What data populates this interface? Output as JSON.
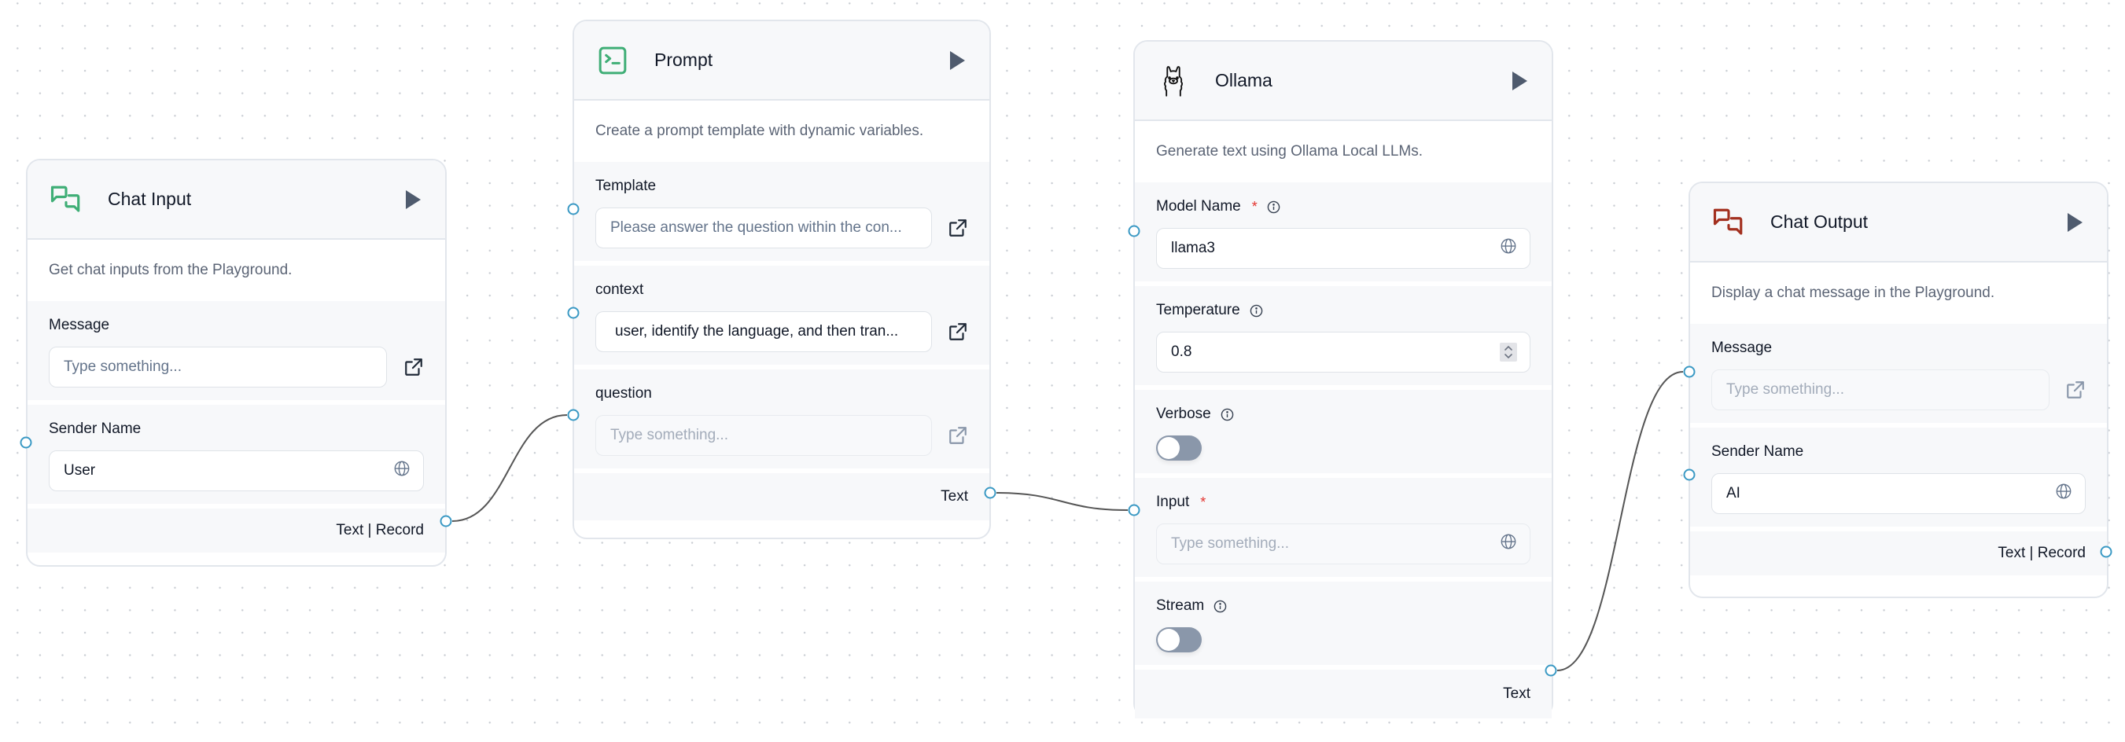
{
  "canvas": {
    "edge_color": "#555555",
    "handle_color": "#3a99c4"
  },
  "nodes": {
    "chat_input": {
      "title": "Chat Input",
      "icon": "chat-bubbles-icon",
      "icon_color": "#3fae76",
      "description": "Get chat inputs from the Playground.",
      "fields": {
        "message": {
          "label": "Message",
          "value": "",
          "placeholder": "Type something..."
        },
        "sender_name": {
          "label": "Sender Name",
          "value": "User"
        }
      },
      "output": "Text | Record"
    },
    "prompt": {
      "title": "Prompt",
      "icon": "terminal-square-icon",
      "icon_color": "#3fae76",
      "description": "Create a prompt template with dynamic variables.",
      "fields": {
        "template": {
          "label": "Template",
          "value": "Please answer the question within the con..."
        },
        "context": {
          "label": "context",
          "value": "user, identify the language, and then tran..."
        },
        "question": {
          "label": "question",
          "value": "",
          "placeholder": "Type something..."
        }
      },
      "output": "Text"
    },
    "ollama": {
      "title": "Ollama",
      "icon": "llama-icon",
      "description": "Generate text using Ollama Local LLMs.",
      "fields": {
        "model_name": {
          "label": "Model Name",
          "required": "*",
          "value": "llama3"
        },
        "temperature": {
          "label": "Temperature",
          "value": "0.8"
        },
        "verbose": {
          "label": "Verbose",
          "enabled": false
        },
        "input": {
          "label": "Input",
          "required": "*",
          "value": "",
          "placeholder": "Type something..."
        },
        "stream": {
          "label": "Stream",
          "enabled": false
        }
      },
      "output": "Text"
    },
    "chat_output": {
      "title": "Chat Output",
      "icon": "chat-bubbles-icon",
      "icon_color": "#a3301f",
      "description": "Display a chat message in the Playground.",
      "fields": {
        "message": {
          "label": "Message",
          "value": "",
          "placeholder": "Type something..."
        },
        "sender_name": {
          "label": "Sender Name",
          "value": "AI"
        }
      },
      "output": "Text | Record"
    }
  },
  "edges": [
    {
      "from": "chat_input.output",
      "to": "prompt.question"
    },
    {
      "from": "prompt.output",
      "to": "ollama.input"
    },
    {
      "from": "ollama.output",
      "to": "chat_output.message"
    }
  ]
}
